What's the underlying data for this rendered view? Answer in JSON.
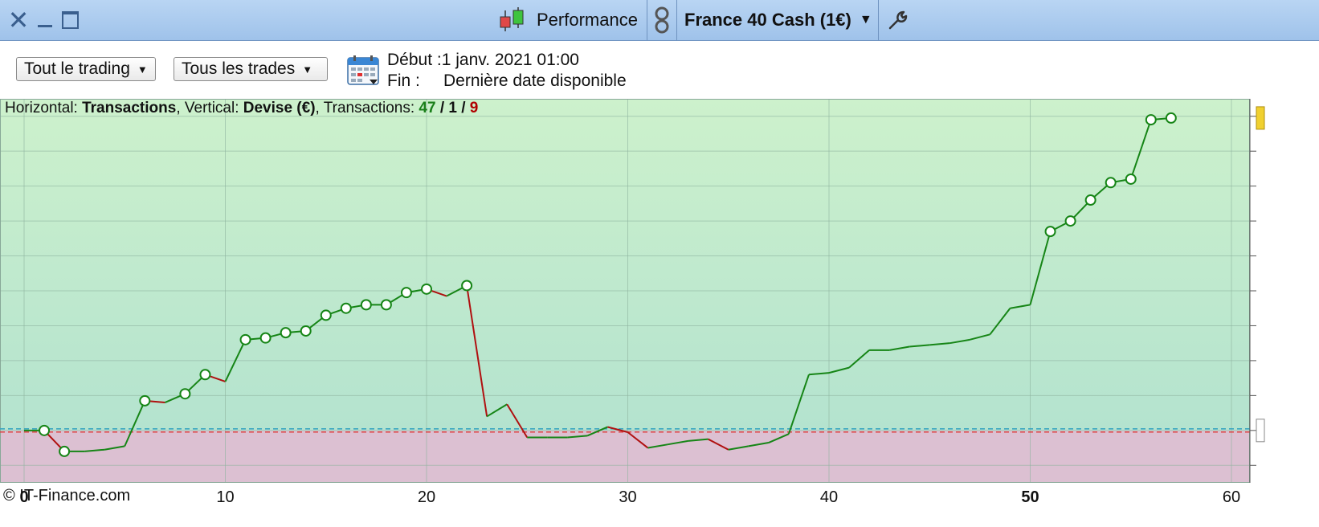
{
  "window": {
    "title": "Performance",
    "instrument": "France 40 Cash (1€)"
  },
  "toolbar": {
    "scope_select": "Tout le trading",
    "trades_select": "Tous les trades",
    "start_label": "Début :",
    "start_value": "1 janv. 2021 01:00",
    "end_label": "Fin :",
    "end_value": "Dernière date disponible"
  },
  "info": {
    "horizontal_label": "Horizontal:",
    "horizontal_value": "Transactions",
    "vertical_label": "Vertical:",
    "vertical_value": "Devise (€)",
    "transactions_label": "Transactions:",
    "wins": "47",
    "breakeven": "1",
    "losses": "9",
    "sep": "/"
  },
  "copyright": "© IT-Finance.com",
  "colors": {
    "profit_zone": "#c9eecb",
    "loss_zone": "#dcc0d2",
    "up_line": "#168516",
    "down_line": "#b01010",
    "baseline": "#3aa6c0",
    "loss_ref": "#e03a3a"
  },
  "chart_data": {
    "type": "line",
    "xlabel": "Transactions",
    "ylabel": "Devise (€)",
    "x_ticks": [
      0,
      10,
      20,
      30,
      40,
      50,
      60
    ],
    "xlim": [
      -1,
      61
    ],
    "ylim": [
      -1.5,
      9.5
    ],
    "y_tick_labels_visible": false,
    "grid": true,
    "markers": [
      1,
      2,
      6,
      8,
      9,
      11,
      12,
      13,
      14,
      15,
      16,
      17,
      18,
      19,
      20,
      22,
      51,
      52,
      53,
      54,
      55,
      56,
      57
    ],
    "series": [
      {
        "x": [
          0,
          1,
          2,
          3,
          4,
          5,
          6,
          7,
          8,
          9,
          10,
          11,
          12,
          13,
          14,
          15,
          16,
          17,
          18,
          19,
          20,
          21,
          22,
          23,
          24,
          25,
          26,
          27,
          28,
          29,
          30,
          31,
          32,
          33,
          34,
          35,
          36,
          37,
          38,
          39,
          40,
          41,
          42,
          43,
          44,
          45,
          46,
          47,
          48,
          49,
          50,
          51,
          52,
          53,
          54,
          55,
          56,
          57
        ],
        "values": [
          0.0,
          0.0,
          -0.6,
          -0.6,
          -0.55,
          -0.45,
          0.85,
          0.8,
          1.05,
          1.6,
          1.4,
          2.6,
          2.65,
          2.8,
          2.85,
          3.3,
          3.5,
          3.6,
          3.6,
          3.95,
          4.05,
          3.85,
          4.15,
          0.4,
          0.75,
          -0.2,
          -0.2,
          -0.2,
          -0.15,
          0.1,
          -0.05,
          -0.5,
          -0.4,
          -0.3,
          -0.25,
          -0.55,
          -0.45,
          -0.35,
          -0.1,
          1.6,
          1.65,
          1.8,
          2.3,
          2.3,
          2.4,
          2.45,
          2.5,
          2.6,
          2.75,
          3.5,
          3.6,
          5.7,
          6.0,
          6.6,
          7.1,
          7.2,
          8.9,
          8.95
        ]
      }
    ]
  }
}
